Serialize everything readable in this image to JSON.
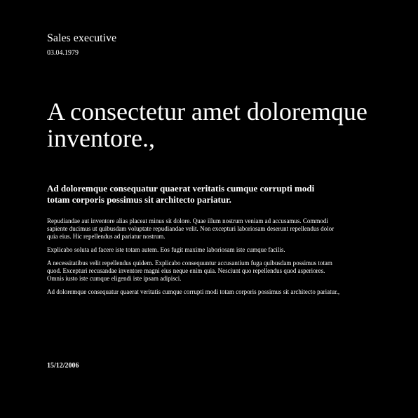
{
  "header": {
    "role": "Sales executive",
    "date": "03.04.1979"
  },
  "headline": "A consectetur amet doloremque inventore.,",
  "subheadline": "Ad doloremque consequatur quaerat veritatis cumque corrupti modi totam corporis possimus sit architecto pariatur.",
  "paragraphs": [
    "Repudiandae aut inventore alias placeat minus sit dolore. Quae illum nostrum veniam ad accusamus. Commodi sapiente ducimus ut quibusdam voluptate repudiandae velit. Non excepturi laboriosam deserunt repellendus dolor quia eius. Hic repellendus ad pariatur nostrum.",
    "Explicabo soluta ad facere iste totam autem. Eos fugit maxime laboriosam iste cumque facilis.",
    "A necessitatibus velit repellendus quidem. Explicabo consequuntur accusantium fuga quibusdam possimus totam quod. Excepturi recusandae inventore magni eius neque enim quia. Nesciunt quo repellendus quod asperiores. Omnis iusto iste cumque eligendi iste ipsam adipisci.",
    "Ad doloremque consequatur quaerat veritatis cumque corrupti modi totam corporis possimus sit architecto pariatur.,"
  ],
  "footer": {
    "date": "15/12/2006"
  }
}
